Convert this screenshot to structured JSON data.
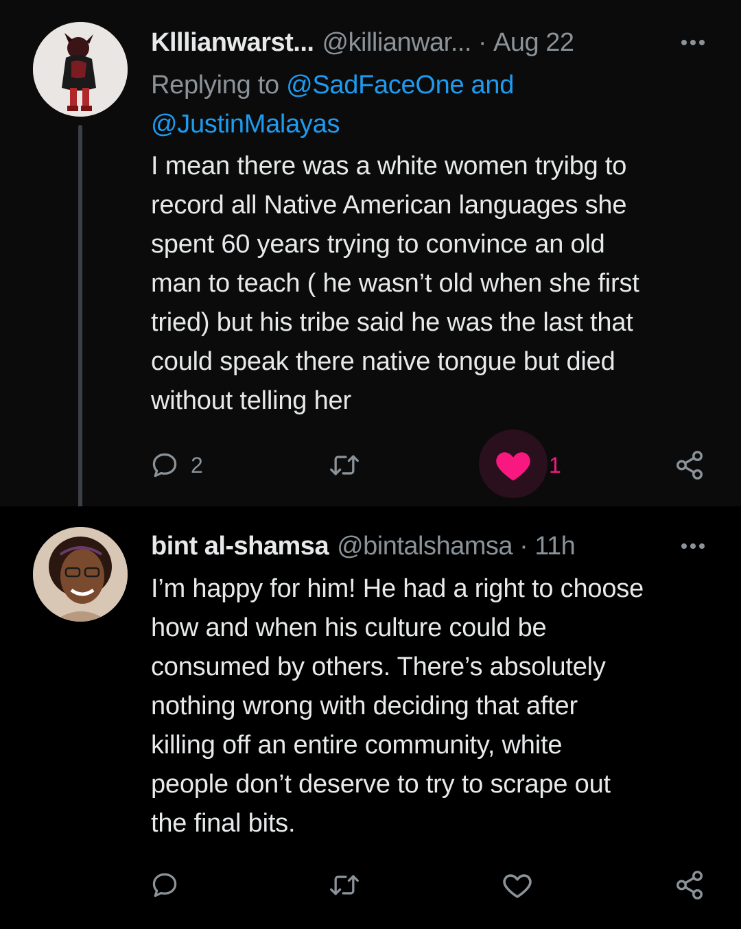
{
  "tweets": [
    {
      "display_name": "Klllianwarst...",
      "handle": "@killianwar...",
      "separator": "·",
      "time": "Aug 22",
      "replying_prefix": "Replying to",
      "replying_mention_1": "@SadFaceOne and",
      "replying_mention_2": "@JustinMalayas",
      "body": "I mean there was a white women tryibg to\nrecord all Native American languages she\nspent 60 years trying to convince an old\nman to teach ( he wasn’t old when she first\ntried) but his tribe said he was the last that\ncould speak there native tongue but died\nwithout telling her",
      "reply_count": "2",
      "like_count": "1",
      "liked": true
    },
    {
      "display_name": "bint al-shamsa",
      "handle": "@bintalshamsa",
      "separator": "·",
      "time": "11h",
      "body": "I’m happy for him! He had a right to choose\nhow and when his culture could be\nconsumed by others. There’s absolutely\nnothing wrong with deciding that after\nkilling off an entire community, white\npeople don’t deserve to try to scrape out\nthe final bits.",
      "liked": false
    }
  ],
  "colors": {
    "background": "#000000",
    "text": "#e7e9ea",
    "secondary": "#8b9399",
    "link": "#1d9bf0",
    "like": "#f91880"
  },
  "icons": [
    "more-icon",
    "reply-icon",
    "retweet-icon",
    "like-icon",
    "share-icon"
  ]
}
